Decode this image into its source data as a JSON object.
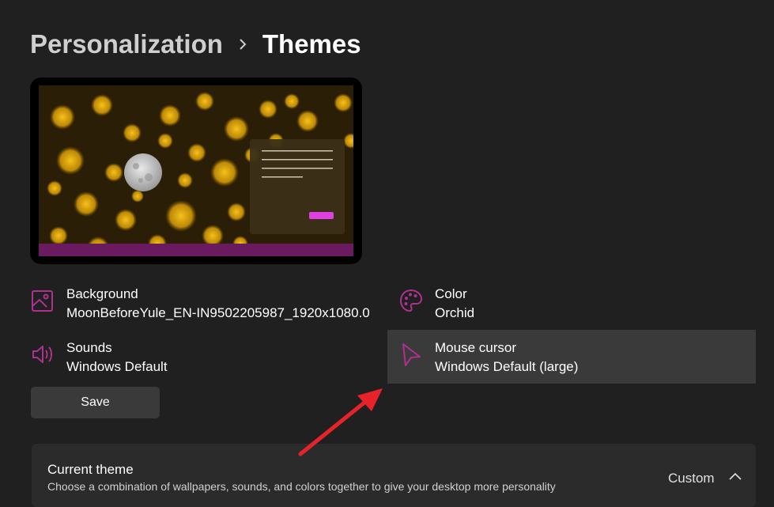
{
  "breadcrumb": {
    "parent": "Personalization",
    "current": "Themes"
  },
  "preview": {
    "accent_color": "#e040e0",
    "taskbar_color": "#6a1a5e"
  },
  "properties": {
    "background": {
      "label": "Background",
      "value": "MoonBeforeYule_EN-IN9502205987_1920x1080.0",
      "icon": "image-icon"
    },
    "color": {
      "label": "Color",
      "value": "Orchid",
      "icon": "palette-icon"
    },
    "sounds": {
      "label": "Sounds",
      "value": "Windows Default",
      "icon": "speaker-icon"
    },
    "mouse_cursor": {
      "label": "Mouse cursor",
      "value": "Windows Default (large)",
      "icon": "cursor-icon"
    }
  },
  "save_label": "Save",
  "current_theme": {
    "title": "Current theme",
    "description": "Choose a combination of wallpapers, sounds, and colors together to give your desktop more personality",
    "value": "Custom"
  },
  "icon_color": "#b0308f",
  "annotation_arrow_color": "#e8222a"
}
